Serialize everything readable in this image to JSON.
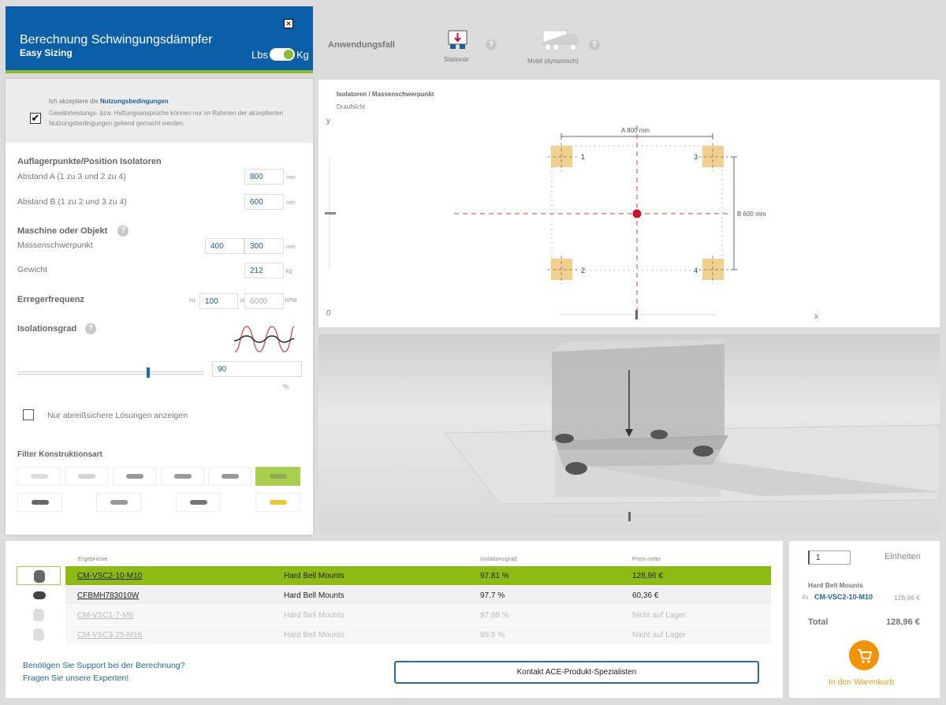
{
  "header": {
    "title": "Berechnung Schwingungsdämpfer",
    "subtitle": "Easy Sizing",
    "unit_left": "Lbs",
    "unit_right": "Kg",
    "unit_selected": "Kg",
    "close_icon": "close-icon"
  },
  "terms": {
    "checked": true,
    "accept_prefix": "Ich akzeptiere die ",
    "accept_link": "Nutzungsbedingungen",
    "note": "Gewährleistungs- bzw. Haftungsansprüche können nur im Rahmen der akzeptierten Nutzungsbedingungen geltend gemacht werden."
  },
  "support": {
    "title": "Auflagerpunkte/Position Isolatoren",
    "a_label": "Abstand A (1 zu 3 und 2 zu 4)",
    "a_value": "800",
    "b_label": "Abstand B (1 zu 2 und 3 zu 4)",
    "b_value": "600",
    "unit": "mm"
  },
  "machine": {
    "title": "Maschine oder Objekt",
    "cg_label": "Massenschwerpunkt",
    "cg_x": "400",
    "cg_y": "300",
    "cg_unit": "mm",
    "weight_label": "Gewicht",
    "weight_value": "212",
    "weight_unit": "kg"
  },
  "frequency": {
    "title": "Erregerfrequenz",
    "hz_label": "Hz",
    "hz_value": "100",
    "or": "or",
    "rpm_value": "6000",
    "rpm_label": "RPM"
  },
  "isolation": {
    "title": "Isolationsgrad",
    "value": "90",
    "unit": "%",
    "slider_percent": 90
  },
  "tearproof": {
    "label": "Nur abreißsichere Lösungen anzeigen",
    "checked": false
  },
  "filter": {
    "title": "Filter Konstruktionsart",
    "selected_index": 5,
    "count": 10
  },
  "application": {
    "title": "Anwendungsfall",
    "options": [
      {
        "label": "Stationär",
        "selected": true
      },
      {
        "label": "Mobil (dynamisch)",
        "selected": false
      }
    ]
  },
  "diagram": {
    "title": "Isolatoren / Massenschwerpunkt",
    "subtitle": "Draufsicht",
    "y_label": "y",
    "x_label": "x",
    "origin": "0",
    "a_dim": "A 800 mm",
    "b_dim": "B 600 mm",
    "isolators": [
      "1",
      "2",
      "3",
      "4"
    ],
    "colors": {
      "isolator": "#f2cf8f",
      "cg": "#c8102e"
    }
  },
  "results": {
    "headers": {
      "name": "Ergebnisse",
      "iso": "Isolationsgrad",
      "price": "Preis netto"
    },
    "rows": [
      {
        "code": "CM-VSC2-10-M10",
        "type": "Hard Bell Mounts",
        "iso": "97.81 %",
        "price": "128,96 €",
        "state": "selected"
      },
      {
        "code": "CFBMH783010W",
        "type": "Hard Bell Mounts",
        "iso": "97.7 %",
        "price": "60,36 €",
        "state": "available"
      },
      {
        "code": "CM-VSC1-7-M6",
        "type": "Hard Bell Mounts",
        "iso": "97.98 %",
        "price": "Nicht auf Lager",
        "state": "disabled"
      },
      {
        "code": "CM-VSC3-25-M16",
        "type": "Hard Bell Mounts",
        "iso": "95.5 %",
        "price": "Nicht auf Lager",
        "state": "disabled"
      }
    ],
    "support_line1": "Benötigen Sie Support bei der Berechnung?",
    "support_line2": "Fragen Sie unsere Experten!",
    "contact_button": "Kontakt ACE-Produkt-Spezialisten"
  },
  "cart": {
    "qty": "1",
    "units": "Einheiten",
    "group": "Hard Bell Mounts",
    "item_qty": "4x",
    "item_code": "CM-VSC2-10-M10",
    "item_price": "128,96 €",
    "total_label": "Total",
    "total": "128,96 €",
    "button": "In den Warenkorb",
    "accent": "#f39200"
  }
}
